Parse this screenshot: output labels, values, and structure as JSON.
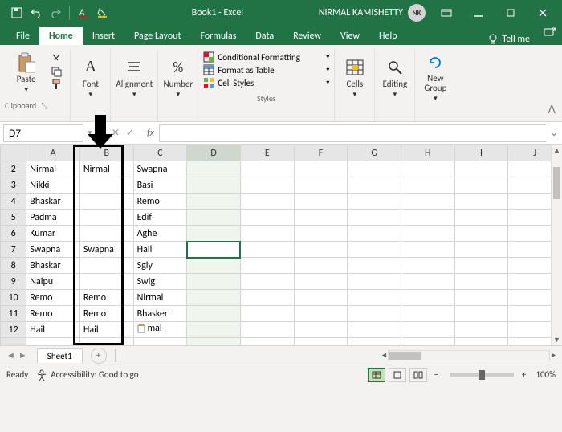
{
  "titlebar": {
    "doc_title": "Book1 - Excel",
    "user_name": "NIRMAL KAMISHETTY",
    "user_initials": "NK"
  },
  "tabs": {
    "file": "File",
    "home": "Home",
    "insert": "Insert",
    "page_layout": "Page Layout",
    "formulas": "Formulas",
    "data": "Data",
    "review": "Review",
    "view": "View",
    "help": "Help",
    "tell_me": "Tell me"
  },
  "ribbon": {
    "paste": "Paste",
    "clipboard": "Clipboard",
    "font": "Font",
    "alignment": "Alignment",
    "number": "Number",
    "cond_fmt": "Conditional Formatting",
    "as_table": "Format as Table",
    "cell_styles": "Cell Styles",
    "styles": "Styles",
    "cells": "Cells",
    "editing": "Editing",
    "new_group": "New\nGroup"
  },
  "namebox": {
    "ref": "D7",
    "fx": "fx"
  },
  "columns": [
    "A",
    "B",
    "C",
    "D",
    "E",
    "F",
    "G",
    "H",
    "I",
    "J"
  ],
  "rows": [
    {
      "n": "2",
      "A": "Nirmal",
      "B": "Nirmal",
      "C": "Swapna"
    },
    {
      "n": "3",
      "A": "Nikki",
      "B": "",
      "C": "Basi"
    },
    {
      "n": "4",
      "A": "Bhaskar",
      "B": "",
      "C": "Remo"
    },
    {
      "n": "5",
      "A": "Padma",
      "B": "",
      "C": "Edif"
    },
    {
      "n": "6",
      "A": "Kumar",
      "B": "",
      "C": "Aghe"
    },
    {
      "n": "7",
      "A": "Swapna",
      "B": "Swapna",
      "C": "Hail"
    },
    {
      "n": "8",
      "A": "Bhaskar",
      "B": "",
      "C": "Sgiy"
    },
    {
      "n": "9",
      "A": "Naipu",
      "B": "",
      "C": "Swig"
    },
    {
      "n": "10",
      "A": "Remo",
      "B": "Remo",
      "C": "Nirmal"
    },
    {
      "n": "11",
      "A": "Remo",
      "B": "Remo",
      "C": "Bhasker"
    },
    {
      "n": "12",
      "A": "Hail",
      "B": "Hail",
      "C": "mal"
    }
  ],
  "sheet": {
    "sheet1": "Sheet1",
    "add": "+"
  },
  "status": {
    "ready": "Ready",
    "acc": "Accessibility: Good to go",
    "zoom": "100%",
    "minus": "−",
    "plus": "+"
  }
}
